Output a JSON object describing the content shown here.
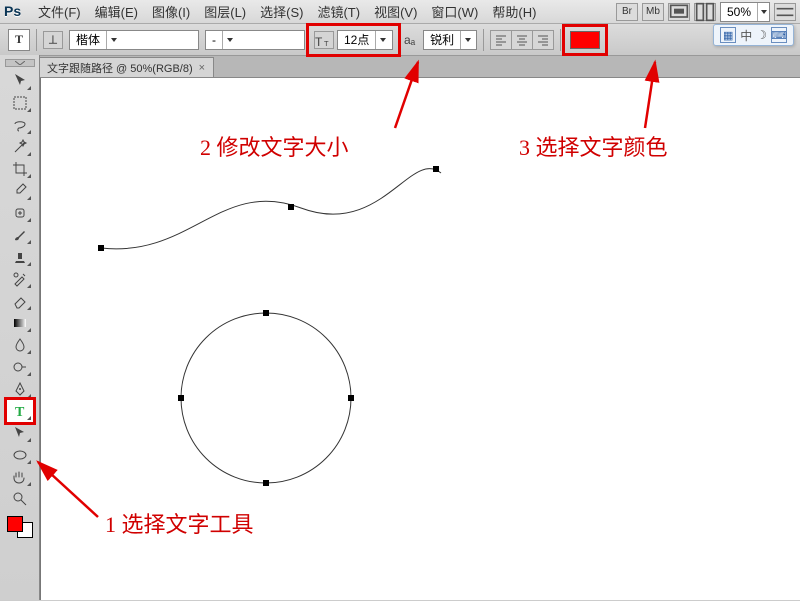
{
  "app_logo": "Ps",
  "menu": {
    "file": "文件(F)",
    "edit": "编辑(E)",
    "image": "图像(I)",
    "layer": "图层(L)",
    "select": "选择(S)",
    "filter": "滤镜(T)",
    "view": "视图(V)",
    "window": "窗口(W)",
    "help": "帮助(H)"
  },
  "menubar_right": {
    "br": "Br",
    "mb": "Mb",
    "zoom_value": "50%"
  },
  "options": {
    "tool_glyph": "T",
    "orient_glyph": "丄",
    "font_family": "楷体",
    "font_style": "-",
    "font_size": "12点",
    "aa_label": "aₐ",
    "antialias": "锐利"
  },
  "tab": {
    "title": "文字跟随路径 @ 50%(RGB/8)",
    "close": "×"
  },
  "ime": {
    "ch": "中"
  },
  "annotations": {
    "a1": "1 选择文字工具",
    "a2": "2 修改文字大小",
    "a3": "3 选择文字颜色"
  }
}
